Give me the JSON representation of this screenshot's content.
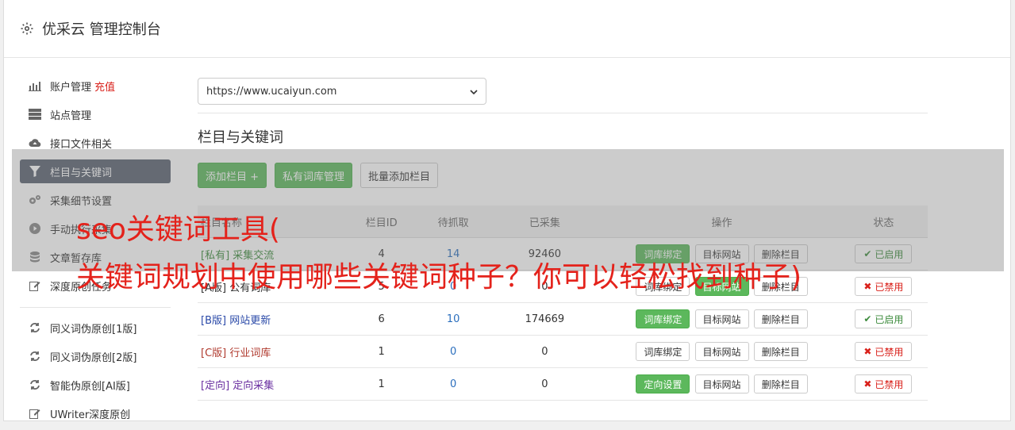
{
  "header": {
    "title": "优采云 管理控制台"
  },
  "sidebar": {
    "items": [
      {
        "label": "账户管理",
        "badge": "充值",
        "icon": "bar-chart-icon"
      },
      {
        "label": "站点管理",
        "icon": "server-icon"
      },
      {
        "label": "接口文件相关",
        "icon": "cloud-upload-icon"
      },
      {
        "label": "栏目与关键词",
        "icon": "filter-icon",
        "active": true
      },
      {
        "label": "采集细节设置",
        "icon": "gears-icon"
      },
      {
        "label": "手动执行采集",
        "icon": "play-circle-icon"
      },
      {
        "label": "文章暂存库",
        "icon": "database-icon"
      },
      {
        "label": "深度原创任务",
        "icon": "edit-icon"
      }
    ],
    "items2": [
      {
        "label": "同义词伪原创[1版]",
        "icon": "refresh-icon"
      },
      {
        "label": "同义词伪原创[2版]",
        "icon": "refresh-icon"
      },
      {
        "label": "智能伪原创[AI版]",
        "icon": "refresh-icon"
      },
      {
        "label": "UWriter深度原创",
        "icon": "edit-icon"
      }
    ]
  },
  "main": {
    "site_select": "https://www.ucaiyun.com",
    "section_title": "栏目与关键词",
    "toolbar": {
      "add_column": "添加栏目 +",
      "private_lib": "私有词库管理",
      "batch_add": "批量添加栏目"
    },
    "table": {
      "headers": [
        "栏目名称",
        "栏目ID",
        "待抓取",
        "已采集",
        "操作",
        "状态"
      ],
      "rows": [
        {
          "tag": "[私有]",
          "name": "采集交流",
          "id": "4",
          "pending": "14",
          "collected": "92460",
          "action1": "词库绑定",
          "action2": "目标网站",
          "action3": "删除栏目",
          "status": "已启用"
        },
        {
          "tag": "[A版]",
          "name": "公有词库",
          "id": "5",
          "pending": "0",
          "collected": "0",
          "action1": "词库绑定",
          "action2": "目标网站",
          "action3": "删除栏目",
          "status": "已禁用"
        },
        {
          "tag": "[B版]",
          "name": "网站更新",
          "id": "6",
          "pending": "10",
          "collected": "174669",
          "action1": "词库绑定",
          "action2": "目标网站",
          "action3": "删除栏目",
          "status": "已启用"
        },
        {
          "tag": "[C版]",
          "name": "行业词库",
          "id": "1",
          "pending": "0",
          "collected": "0",
          "action1": "词库绑定",
          "action2": "目标网站",
          "action3": "删除栏目",
          "status": "已禁用"
        },
        {
          "tag": "[定向]",
          "name": "定向采集",
          "id": "1",
          "pending": "0",
          "collected": "0",
          "action1": "定向设置",
          "action2": "目标网站",
          "action3": "删除栏目",
          "status": "已禁用"
        }
      ]
    }
  },
  "overlay": {
    "line1": "seo关键词工具(",
    "line2": "关键词规划中使用哪些关键词种子？你可以轻松找到种子)"
  },
  "colors": {
    "accent_green": "#5cb85c",
    "active_nav": "#5a6270",
    "overlay_text": "#e4221b"
  }
}
